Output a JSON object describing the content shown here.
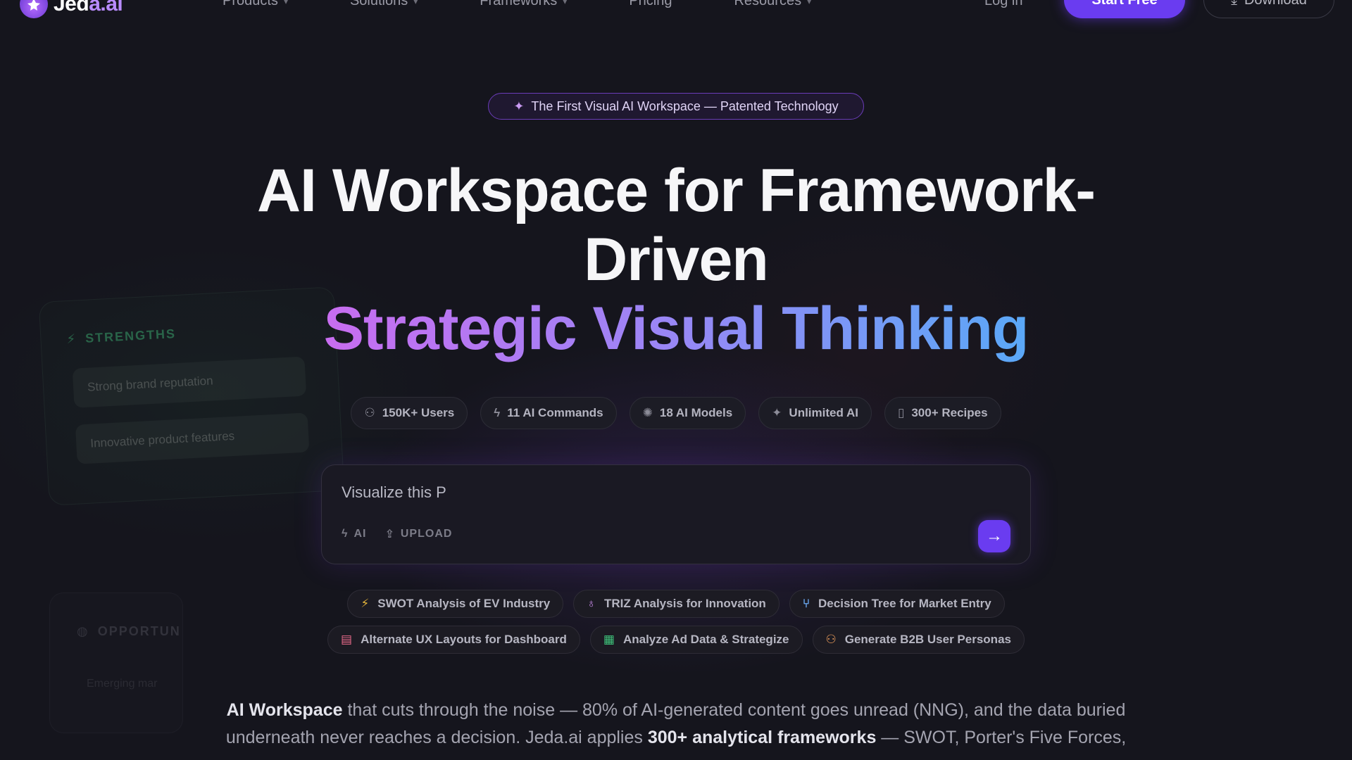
{
  "nav": {
    "logo_text_main": "Jed",
    "logo_text_accent": "a.ai",
    "links": [
      {
        "label": "Products",
        "dropdown": true
      },
      {
        "label": "Solutions",
        "dropdown": true
      },
      {
        "label": "Frameworks",
        "dropdown": true
      },
      {
        "label": "Pricing",
        "dropdown": false
      },
      {
        "label": "Resources",
        "dropdown": true
      }
    ],
    "login": "Log in",
    "start_free": "Start Free",
    "download": "Download"
  },
  "badge": {
    "text": "The First Visual AI Workspace — Patented Technology",
    "icon": "sparkle-icon"
  },
  "headline": {
    "line1": "AI Workspace for Framework-",
    "line2": "Driven",
    "line3": "Strategic Visual Thinking"
  },
  "stats": [
    {
      "label": "150K+ Users",
      "icon": "users-icon"
    },
    {
      "label": "11 AI Commands",
      "icon": "bolt-icon"
    },
    {
      "label": "18 AI Models",
      "icon": "brain-icon"
    },
    {
      "label": "Unlimited AI",
      "icon": "sparkle-icon"
    },
    {
      "label": "300+ Recipes",
      "icon": "book-icon"
    }
  ],
  "prompt": {
    "value": "Visualize this P",
    "ai_label": "AI",
    "upload_label": "UPLOAD"
  },
  "suggestions_row1": [
    {
      "label": "SWOT Analysis of EV Industry",
      "icon": "bolt-icon",
      "color": "#e0b13a"
    },
    {
      "label": "TRIZ Analysis for Innovation",
      "icon": "bulb-icon",
      "color": "#c88ae8"
    },
    {
      "label": "Decision Tree for Market Entry",
      "icon": "branch-icon",
      "color": "#6aa8f0"
    }
  ],
  "suggestions_row2": [
    {
      "label": "Alternate UX Layouts for Dashboard",
      "icon": "layout-icon",
      "color": "#e86a8a"
    },
    {
      "label": "Analyze Ad Data & Strategize",
      "icon": "sheet-icon",
      "color": "#3ec27a"
    },
    {
      "label": "Generate B2B User Personas",
      "icon": "people-icon",
      "color": "#e89a5a"
    }
  ],
  "background_cards": {
    "strengths_title": "STRENGTHS",
    "strengths_items": [
      "Strong brand reputation",
      "Innovative product features"
    ],
    "opportunities_title": "OPPORTUN",
    "opportunities_item": "Emerging mar"
  },
  "paragraph": {
    "bold1": "AI Workspace",
    "text1": " that cuts through the noise — 80% of AI-generated content goes unread (NNG), and the data buried underneath never reaches a decision. Jeda.ai applies ",
    "bold2": "300+ analytical frameworks",
    "text2": " — SWOT, Porter's Five Forces,"
  },
  "colors": {
    "accent": "#6a3cf0",
    "background": "#15151d",
    "gradient_start": "#c86df0",
    "gradient_end": "#5aa8f7"
  }
}
